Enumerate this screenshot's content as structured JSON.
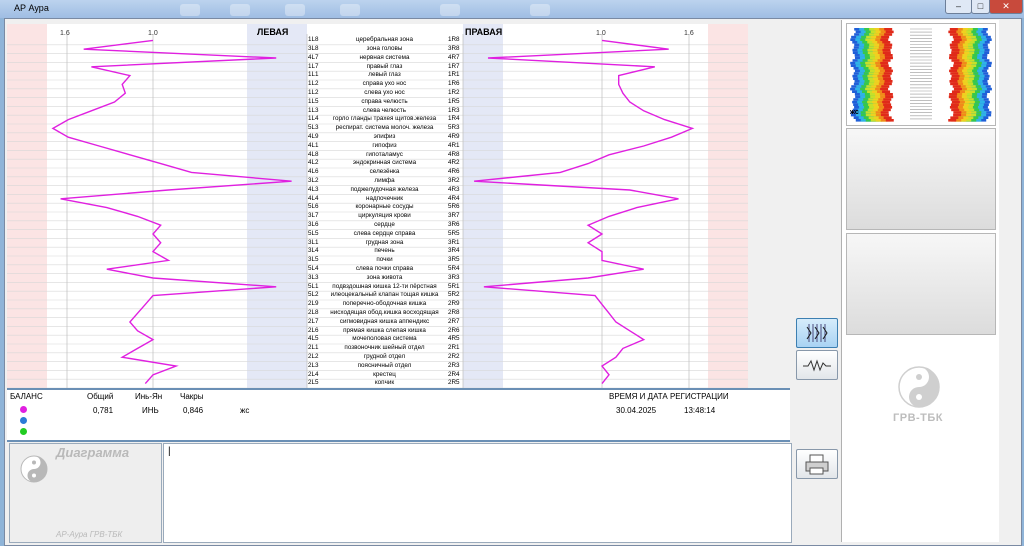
{
  "window": {
    "title": "АР Аура"
  },
  "chart_data": {
    "type": "line",
    "x_ticks_left": [
      "1.6",
      "1.0"
    ],
    "x_ticks_right": [
      "1.0",
      "1.6"
    ],
    "left_header": "ЛЕВАЯ",
    "right_header": "ПРАВАЯ",
    "rows": [
      {
        "l": "1L8",
        "name": "церебральная зона",
        "r": "1R8",
        "lv": 1.0,
        "rv": 1.0
      },
      {
        "l": "3L8",
        "name": "зона головы",
        "r": "3R8",
        "lv": 1.45,
        "rv": 1.48
      },
      {
        "l": "4L7",
        "name": "нервная система",
        "r": "4R7",
        "lv": 0.2,
        "rv": 0.18
      },
      {
        "l": "1L7",
        "name": "правый глаз",
        "r": "1R7",
        "lv": 1.4,
        "rv": 1.38
      },
      {
        "l": "1L1",
        "name": "левый глаз",
        "r": "1R1",
        "lv": 1.15,
        "rv": 1.12
      },
      {
        "l": "1L2",
        "name": "справа ухо  нос",
        "r": "1R6",
        "lv": 1.2,
        "rv": 1.12
      },
      {
        "l": "1L2",
        "name": "слева ухо  нос",
        "r": "1R2",
        "lv": 1.18,
        "rv": 1.15
      },
      {
        "l": "1L5",
        "name": "справа челюсть",
        "r": "1R5",
        "lv": 1.25,
        "rv": 1.2
      },
      {
        "l": "1L3",
        "name": "слева челюсть",
        "r": "1R3",
        "lv": 1.4,
        "rv": 1.3
      },
      {
        "l": "1L4",
        "name": "горло гланды трахея щитов.железа",
        "r": "1R4",
        "lv": 1.55,
        "rv": 1.45
      },
      {
        "l": "5L3",
        "name": "респират. система молоч. железа",
        "r": "5R3",
        "lv": 1.65,
        "rv": 1.65
      },
      {
        "l": "4L9",
        "name": "эпифиз",
        "r": "4R9",
        "lv": 1.55,
        "rv": 1.5
      },
      {
        "l": "4L1",
        "name": "гипофиз",
        "r": "4R1",
        "lv": 1.35,
        "rv": 1.3
      },
      {
        "l": "4L8",
        "name": "гипоталамус",
        "r": "4R8",
        "lv": 1.15,
        "rv": 1.05
      },
      {
        "l": "4L2",
        "name": "эндокринная система",
        "r": "4R2",
        "lv": 0.95,
        "rv": 0.9
      },
      {
        "l": "4L6",
        "name": "селезёнка",
        "r": "4R6",
        "lv": 0.75,
        "rv": 0.7
      },
      {
        "l": "3L2",
        "name": "лимфа",
        "r": "3R2",
        "lv": 0.1,
        "rv": 0.08
      },
      {
        "l": "4L3",
        "name": "поджелудочная железа",
        "r": "4R3",
        "lv": 0.9,
        "rv": 1.2
      },
      {
        "l": "4L4",
        "name": "надпочечник",
        "r": "4R4",
        "lv": 1.6,
        "rv": 1.55
      },
      {
        "l": "5L6",
        "name": "коронарные сосуды",
        "r": "5R6",
        "lv": 1.3,
        "rv": 1.25
      },
      {
        "l": "3L7",
        "name": "циркуляция крови",
        "r": "3R7",
        "lv": 1.1,
        "rv": 1.05
      },
      {
        "l": "3L6",
        "name": "сердце",
        "r": "3R6",
        "lv": 0.95,
        "rv": 0.9
      },
      {
        "l": "5L5",
        "name": "слева       сердце         справа",
        "r": "5R5",
        "lv": 1.0,
        "rv": 1.0
      },
      {
        "l": "3L1",
        "name": "грудная зона",
        "r": "3R1",
        "lv": 0.95,
        "rv": 0.9
      },
      {
        "l": "3L4",
        "name": "печень",
        "r": "3R4",
        "lv": 1.0,
        "rv": 1.0
      },
      {
        "l": "3L5",
        "name": "почки",
        "r": "3R5",
        "lv": 0.9,
        "rv": 1.0
      },
      {
        "l": "5L4",
        "name": "слева         почки          справа",
        "r": "5R4",
        "lv": 1.3,
        "rv": 1.3
      },
      {
        "l": "3L3",
        "name": "зона живота",
        "r": "3R3",
        "lv": 1.0,
        "rv": 0.9
      },
      {
        "l": "5L1",
        "name": "подвздошная  кишка 12-ти пёрстная",
        "r": "5R1",
        "lv": 0.2,
        "rv": 0.15
      },
      {
        "l": "5L2",
        "name": "илеоцекальный клапан тощая кишка",
        "r": "5R2",
        "lv": 1.0,
        "rv": 0.95
      },
      {
        "l": "2L9",
        "name": "поперечно-ободочная кишка",
        "r": "2R9",
        "lv": 1.05,
        "rv": 1.0
      },
      {
        "l": "2L8",
        "name": "нисходящая обод.кишка восходящая",
        "r": "2R8",
        "lv": 1.1,
        "rv": 1.05
      },
      {
        "l": "2L7",
        "name": "сигмовидная кишка  аппендикс",
        "r": "2R7",
        "lv": 1.15,
        "rv": 1.1
      },
      {
        "l": "2L6",
        "name": "прямая кишка   слепая кишка",
        "r": "2R6",
        "lv": 1.1,
        "rv": 1.2
      },
      {
        "l": "4L5",
        "name": "мочеполовая система",
        "r": "4R5",
        "lv": 1.0,
        "rv": 1.3
      },
      {
        "l": "2L1",
        "name": "позвоночник шейный отдел",
        "r": "2R1",
        "lv": 1.1,
        "rv": 1.15
      },
      {
        "l": "2L2",
        "name": "грудной отдел",
        "r": "2R2",
        "lv": 1.2,
        "rv": 1.1
      },
      {
        "l": "2L3",
        "name": "поясничный отдел",
        "r": "2R3",
        "lv": 0.85,
        "rv": 1.0
      },
      {
        "l": "2L4",
        "name": "крестец",
        "r": "2R4",
        "lv": 1.0,
        "rv": 1.05
      },
      {
        "l": "2L5",
        "name": "копчик",
        "r": "2R5",
        "lv": 1.05,
        "rv": 1.0
      }
    ]
  },
  "stats": {
    "balance_label": "БАЛАНС",
    "total_label": "Общий",
    "yin_yang_label": "Инь-Ян",
    "chakras_label": "Чакры",
    "total_value": "0,781",
    "yin_yang_value": "ИНЬ",
    "chakras_value": "0,846",
    "chakras_extra": "жс",
    "datetime_label": "ВРЕМЯ И ДАТА РЕГИСТРАЦИИ",
    "date": "30.04.2025",
    "time": "13:48:14",
    "dot_colors": [
      "#e020e0",
      "#2b7bd6",
      "#22cc22"
    ]
  },
  "diagram": {
    "title": "Диаграмма",
    "footer": "АР-Аура ГРВ-ТБК"
  },
  "notes": {
    "value": "|"
  },
  "sidebar": {
    "thumb_label": "жс",
    "watermark": "ГРВ-ТБК"
  },
  "colors": {
    "line": "#e020e0",
    "pink_band": "#fbe4e4",
    "blue_band": "#e4e8f6"
  },
  "icons": {
    "chart_view": "bars-icon",
    "wave_view": "wave-icon",
    "print": "printer-icon",
    "yinyang": "yin-yang-icon"
  }
}
